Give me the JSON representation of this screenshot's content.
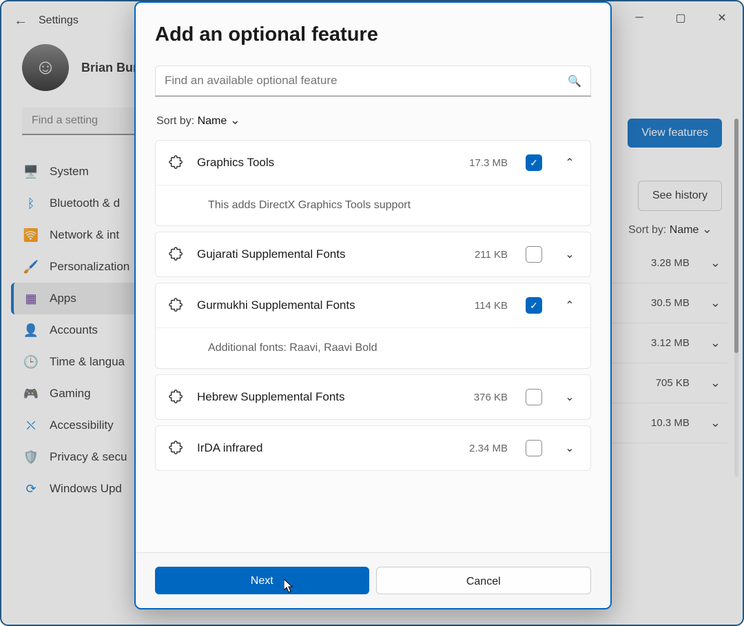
{
  "window": {
    "title": "Settings",
    "min": "─",
    "max": "▢",
    "close": "✕"
  },
  "profile": {
    "name": "Brian Bur"
  },
  "searchSettingPlaceholder": "Find a setting",
  "sidebar": {
    "items": [
      {
        "label": "System",
        "icon": "🖥️",
        "cls": "c-blue"
      },
      {
        "label": "Bluetooth & d",
        "icon": "ᛒ",
        "cls": "c-blue"
      },
      {
        "label": "Network & int",
        "icon": "🛜",
        "cls": "c-blue"
      },
      {
        "label": "Personalization",
        "icon": "🖌️",
        "cls": "c-gray"
      },
      {
        "label": "Apps",
        "icon": "▦",
        "cls": "c-violet",
        "selected": true
      },
      {
        "label": "Accounts",
        "icon": "👤",
        "cls": "c-teal"
      },
      {
        "label": "Time & langua",
        "icon": "🕒",
        "cls": "c-orange"
      },
      {
        "label": "Gaming",
        "icon": "🎮",
        "cls": "c-gray"
      },
      {
        "label": "Accessibility",
        "icon": "⛌",
        "cls": "c-blue"
      },
      {
        "label": "Privacy & secu",
        "icon": "🛡️",
        "cls": "c-gray"
      },
      {
        "label": "Windows Upd",
        "icon": "⟳",
        "cls": "c-blue"
      }
    ]
  },
  "background": {
    "viewFeatures": "View features",
    "seeHistory": "See history",
    "sortLabel": "Sort by:",
    "sortValue": "Name",
    "rows": [
      {
        "size": "3.28 MB"
      },
      {
        "size": "30.5 MB"
      },
      {
        "size": "3.12 MB"
      },
      {
        "size": "705 KB"
      },
      {
        "size": "10.3 MB"
      }
    ]
  },
  "modal": {
    "title": "Add an optional feature",
    "searchPlaceholder": "Find an available optional feature",
    "sortLabel": "Sort by:",
    "sortValue": "Name",
    "features": [
      {
        "name": "Graphics Tools",
        "size": "17.3 MB",
        "checked": true,
        "expanded": true,
        "desc": "This adds DirectX Graphics Tools support"
      },
      {
        "name": "Gujarati Supplemental Fonts",
        "size": "211 KB",
        "checked": false,
        "expanded": false
      },
      {
        "name": "Gurmukhi Supplemental Fonts",
        "size": "114 KB",
        "checked": true,
        "expanded": true,
        "desc": "Additional fonts: Raavi, Raavi Bold"
      },
      {
        "name": "Hebrew Supplemental Fonts",
        "size": "376 KB",
        "checked": false,
        "expanded": false
      },
      {
        "name": "IrDA infrared",
        "size": "2.34 MB",
        "checked": false,
        "expanded": false
      }
    ],
    "nextLabel": "Next",
    "cancelLabel": "Cancel"
  }
}
